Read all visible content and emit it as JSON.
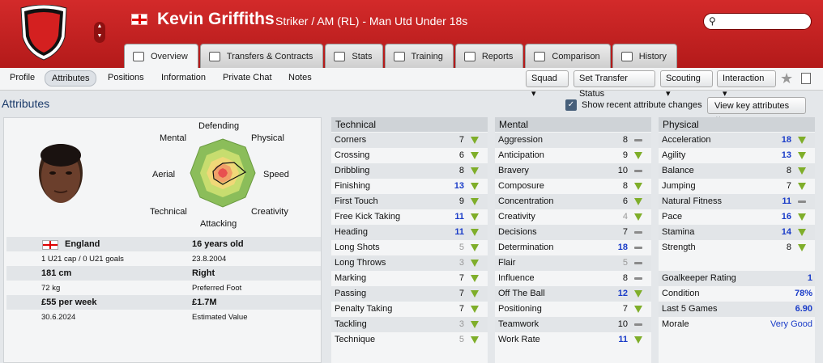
{
  "header": {
    "name": "Kevin Griffiths",
    "subtitle": "Striker / AM (RL) - Man Utd Under 18s"
  },
  "tabs": [
    {
      "label": "Overview",
      "icon": "overview-icon"
    },
    {
      "label": "Transfers & Contracts",
      "icon": "document-icon"
    },
    {
      "label": "Stats",
      "icon": "stats-icon"
    },
    {
      "label": "Training",
      "icon": "ball-icon"
    },
    {
      "label": "Reports",
      "icon": "report-icon"
    },
    {
      "label": "Comparison",
      "icon": "compare-icon"
    },
    {
      "label": "History",
      "icon": "history-icon"
    }
  ],
  "subnav": [
    "Profile",
    "Attributes",
    "Positions",
    "Information",
    "Private Chat",
    "Notes"
  ],
  "actions": {
    "squad": "Squad",
    "transfer": "Set Transfer Status",
    "scouting": "Scouting",
    "interaction": "Interaction"
  },
  "section": {
    "title": "Attributes",
    "show_recent": "Show recent attribute changes",
    "view_key": "View key attributes"
  },
  "radar": {
    "labels": {
      "defending": "Defending",
      "physical": "Physical",
      "speed": "Speed",
      "creativity": "Creativity",
      "attacking": "Attacking",
      "technical": "Technical",
      "aerial": "Aerial",
      "mental": "Mental"
    }
  },
  "profile": {
    "nation": "England",
    "age": "16 years old",
    "caps": "1 U21 cap / 0 U21 goals",
    "dob": "23.8.2004",
    "height": "181 cm",
    "foot": "Right",
    "weight": "72 kg",
    "foot_label": "Preferred Foot",
    "wage": "£55 per week",
    "value": "£1.7M",
    "contract": "30.6.2024",
    "value_label": "Estimated Value"
  },
  "technical": {
    "title": "Technical",
    "rows": [
      {
        "name": "Corners",
        "value": "7",
        "trend": "up"
      },
      {
        "name": "Crossing",
        "value": "6",
        "trend": "up"
      },
      {
        "name": "Dribbling",
        "value": "8",
        "trend": "up"
      },
      {
        "name": "Finishing",
        "value": "13",
        "trend": "up",
        "hl": true
      },
      {
        "name": "First Touch",
        "value": "9",
        "trend": "up"
      },
      {
        "name": "Free Kick Taking",
        "value": "11",
        "trend": "up",
        "hl": true
      },
      {
        "name": "Heading",
        "value": "11",
        "trend": "up",
        "hl": true
      },
      {
        "name": "Long Shots",
        "value": "5",
        "trend": "up",
        "grey": true
      },
      {
        "name": "Long Throws",
        "value": "3",
        "trend": "up",
        "grey": true
      },
      {
        "name": "Marking",
        "value": "7",
        "trend": "up"
      },
      {
        "name": "Passing",
        "value": "7",
        "trend": "up"
      },
      {
        "name": "Penalty Taking",
        "value": "7",
        "trend": "up"
      },
      {
        "name": "Tackling",
        "value": "3",
        "trend": "up",
        "grey": true
      },
      {
        "name": "Technique",
        "value": "5",
        "trend": "up",
        "grey": true
      }
    ]
  },
  "mental": {
    "title": "Mental",
    "rows": [
      {
        "name": "Aggression",
        "value": "8",
        "trend": "flat"
      },
      {
        "name": "Anticipation",
        "value": "9",
        "trend": "up"
      },
      {
        "name": "Bravery",
        "value": "10",
        "trend": "flat"
      },
      {
        "name": "Composure",
        "value": "8",
        "trend": "up"
      },
      {
        "name": "Concentration",
        "value": "6",
        "trend": "up"
      },
      {
        "name": "Creativity",
        "value": "4",
        "trend": "up",
        "grey": true
      },
      {
        "name": "Decisions",
        "value": "7",
        "trend": "flat"
      },
      {
        "name": "Determination",
        "value": "18",
        "trend": "flat",
        "hl": true
      },
      {
        "name": "Flair",
        "value": "5",
        "trend": "flat",
        "grey": true
      },
      {
        "name": "Influence",
        "value": "8",
        "trend": "flat"
      },
      {
        "name": "Off The Ball",
        "value": "12",
        "trend": "up",
        "hl": true
      },
      {
        "name": "Positioning",
        "value": "7",
        "trend": "up"
      },
      {
        "name": "Teamwork",
        "value": "10",
        "trend": "flat"
      },
      {
        "name": "Work Rate",
        "value": "11",
        "trend": "up",
        "hl": true
      }
    ]
  },
  "physical": {
    "title": "Physical",
    "rows": [
      {
        "name": "Acceleration",
        "value": "18",
        "trend": "up",
        "hl": true
      },
      {
        "name": "Agility",
        "value": "13",
        "trend": "up",
        "hl": true
      },
      {
        "name": "Balance",
        "value": "8",
        "trend": "up"
      },
      {
        "name": "Jumping",
        "value": "7",
        "trend": "up"
      },
      {
        "name": "Natural Fitness",
        "value": "11",
        "trend": "flat",
        "hl": true
      },
      {
        "name": "Pace",
        "value": "16",
        "trend": "up",
        "hl": true
      },
      {
        "name": "Stamina",
        "value": "14",
        "trend": "up",
        "hl": true
      },
      {
        "name": "Strength",
        "value": "8",
        "trend": "up"
      }
    ]
  },
  "extras": [
    {
      "name": "Goalkeeper Rating",
      "value": "1"
    },
    {
      "name": "Condition",
      "value": "78%"
    },
    {
      "name": "Last 5 Games",
      "value": "6.90"
    },
    {
      "name": "Morale",
      "value": "Very Good"
    }
  ],
  "colors": {
    "header": "#c42020",
    "highlight": "#1a3cc8",
    "trend_up": "#7fae2a"
  }
}
